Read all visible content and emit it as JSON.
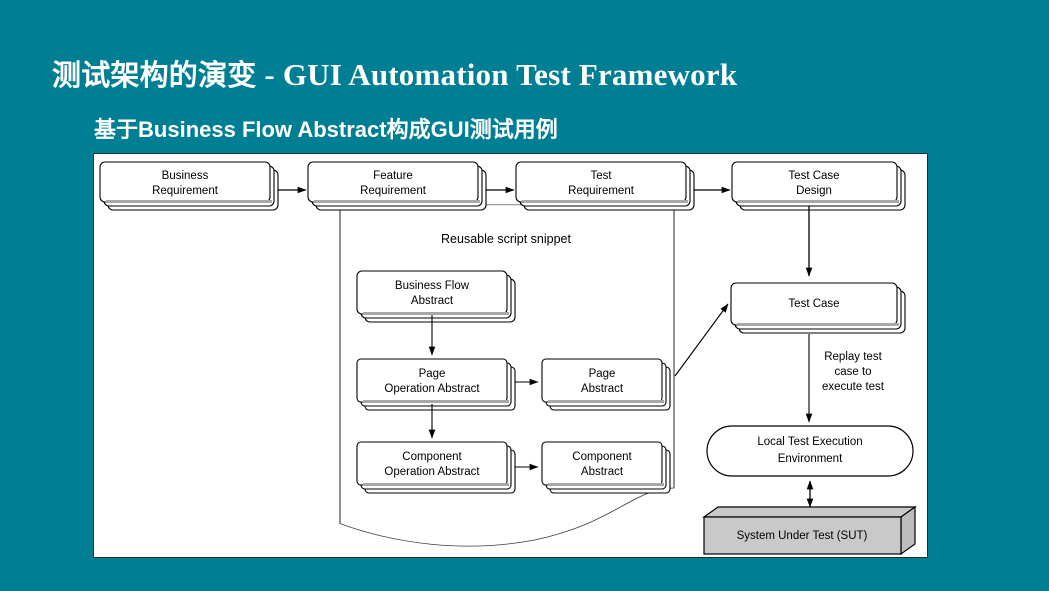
{
  "slide": {
    "background_color": "#007f94",
    "title": {
      "cjk_prefix": "测试架构的演变",
      "separator": " - ",
      "latin": "GUI Automation Test Framework",
      "full": "测试架构的演变 - GUI Automation Test Framework"
    },
    "subtitle": {
      "cjk_prefix": "基于",
      "latin_mid": "Business Flow Abstract",
      "cjk_mid": "构成",
      "latin_tail": "GUI",
      "cjk_suffix": "测试用例",
      "full": "基于Business Flow Abstract构成GUI测试用例"
    }
  },
  "diagram": {
    "panel_background": "#ffffff",
    "panel_border_color": "#2a2a2a",
    "group": {
      "label": "Reusable script snippet"
    },
    "pipeline": [
      {
        "id": "business-requirement",
        "line1": "Business",
        "line2": "Requirement"
      },
      {
        "id": "feature-requirement",
        "line1": "Feature",
        "line2": "Requirement"
      },
      {
        "id": "test-requirement",
        "line1": "Test",
        "line2": "Requirement"
      },
      {
        "id": "test-case-design",
        "line1": "Test Case",
        "line2": "Design"
      }
    ],
    "snippet_nodes": [
      {
        "id": "business-flow-abstract",
        "line1": "Business Flow",
        "line2": "Abstract"
      },
      {
        "id": "page-operation-abstract",
        "line1": "Page",
        "line2": "Operation Abstract"
      },
      {
        "id": "page-abstract",
        "line1": "Page",
        "line2": "Abstract"
      },
      {
        "id": "component-operation-abstract",
        "line1": "Component",
        "line2": "Operation Abstract"
      },
      {
        "id": "component-abstract",
        "line1": "Component",
        "line2": "Abstract"
      }
    ],
    "right_column": {
      "test_case": {
        "id": "test-case",
        "line1": "Test Case",
        "line2": ""
      },
      "replay_label": {
        "line1": "Replay test",
        "line2": "case to",
        "line3": "execute test"
      },
      "environment": {
        "id": "local-test-execution-environment",
        "line1": "Local Test Execution",
        "line2": "Environment"
      },
      "system_under_test": {
        "id": "system-under-test",
        "label": "System Under Test (SUT)",
        "fill_color": "#c9c9c9"
      }
    }
  }
}
